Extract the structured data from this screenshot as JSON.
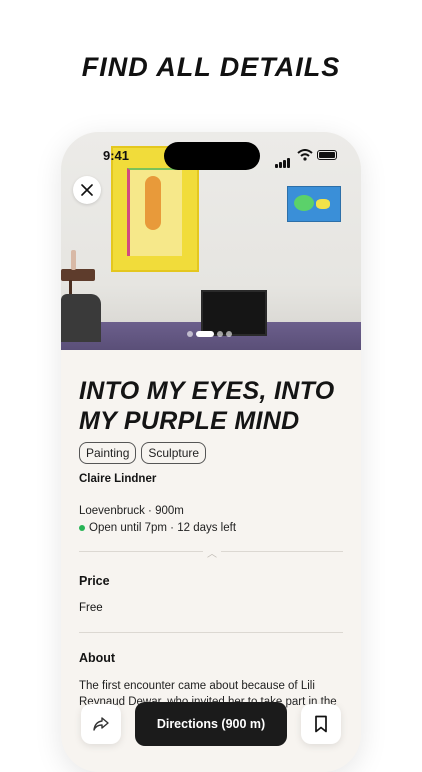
{
  "headline": "FIND ALL DETAILS",
  "status_bar": {
    "time": "9:41"
  },
  "artwork": {
    "title": "INTO MY EYES, INTO MY PURPLE MIND",
    "tags": [
      "Painting",
      "Sculpture"
    ],
    "artist": "Claire Lindner",
    "venue_distance": "Loevenbruck · 900m",
    "open_status": "Open until 7pm · 12 days left",
    "gallery_dots": {
      "count": 4,
      "active_index": 1
    }
  },
  "price": {
    "title": "Price",
    "value": "Free"
  },
  "about": {
    "title": "About",
    "text": "The first encounter came about because of Lili Reynaud Dewar, who invited her to take part in the"
  },
  "actions": {
    "directions_label": "Directions (900 m)"
  },
  "colors": {
    "open_indicator": "#28b456",
    "primary_button": "#1b1b1b",
    "background": "#f7f4f0"
  }
}
